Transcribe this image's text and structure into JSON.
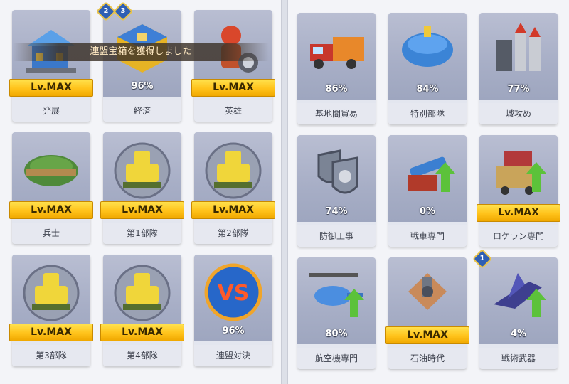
{
  "toast": {
    "message": "連盟宝箱を獲得しました"
  },
  "left_cards": [
    {
      "label": "発展",
      "status": "Lv.MAX",
      "icon": "building-icon"
    },
    {
      "label": "経済",
      "status": "96%",
      "icon": "gold-crate-icon",
      "badges": [
        "2",
        "3"
      ]
    },
    {
      "label": "英雄",
      "status": "Lv.MAX",
      "icon": "hero-icon"
    },
    {
      "label": "兵士",
      "status": "Lv.MAX",
      "icon": "soldier-helmet-icon"
    },
    {
      "label": "第1部隊",
      "status": "Lv.MAX",
      "icon": "tank-emblem-icon"
    },
    {
      "label": "第2部隊",
      "status": "Lv.MAX",
      "icon": "tank-emblem-icon"
    },
    {
      "label": "第3部隊",
      "status": "Lv.MAX",
      "icon": "tank-emblem-icon"
    },
    {
      "label": "第4部隊",
      "status": "Lv.MAX",
      "icon": "tank-emblem-icon"
    },
    {
      "label": "連盟対決",
      "status": "96%",
      "icon": "vs-icon"
    }
  ],
  "right_cards": [
    {
      "label": "基地間貿易",
      "status": "86%",
      "icon": "truck-icon"
    },
    {
      "label": "特別部隊",
      "status": "84%",
      "icon": "special-helmet-icon"
    },
    {
      "label": "城攻め",
      "status": "77%",
      "icon": "missiles-icon"
    },
    {
      "label": "防御工事",
      "status": "74%",
      "icon": "shield-gears-icon"
    },
    {
      "label": "戦車専門",
      "status": "0%",
      "icon": "cannon-upgrade-icon"
    },
    {
      "label": "ロケラン専門",
      "status": "Lv.MAX",
      "icon": "rocket-truck-icon"
    },
    {
      "label": "航空機専門",
      "status": "80%",
      "icon": "helicopter-icon"
    },
    {
      "label": "石油時代",
      "status": "Lv.MAX",
      "icon": "oil-rig-icon"
    },
    {
      "label": "戦術武器",
      "status": "4%",
      "icon": "jet-icon",
      "badges": [
        "1"
      ]
    }
  ],
  "colors": {
    "lvmax_gold": "#ffc21a",
    "card_art": "#a7aec6",
    "badge_blue": "#2f5fb4"
  }
}
